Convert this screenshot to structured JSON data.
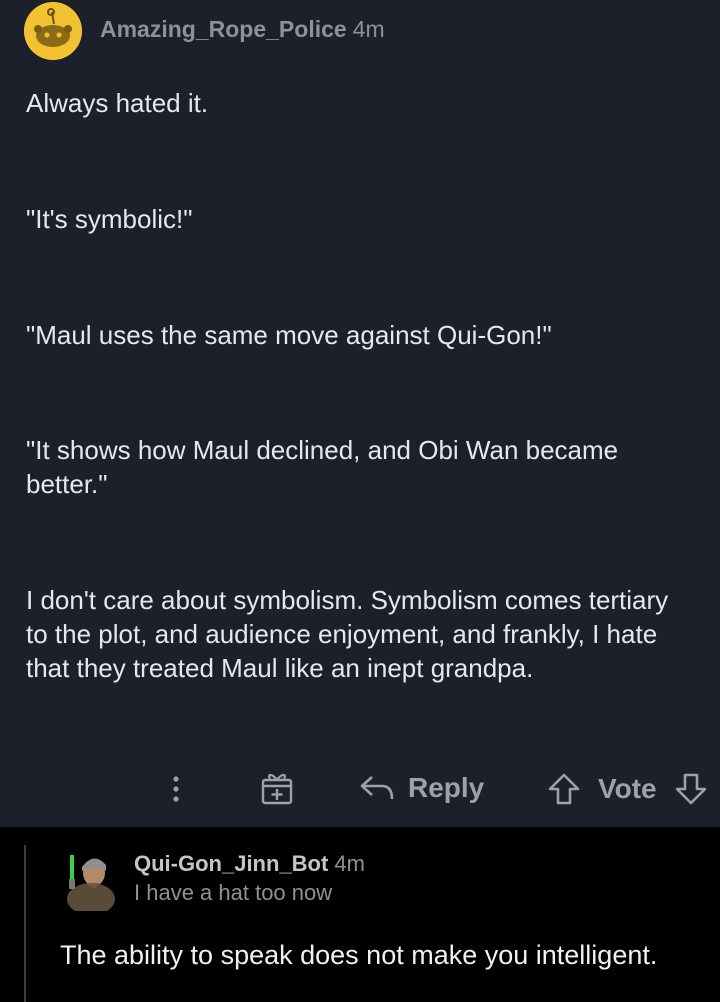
{
  "comment1": {
    "username": "Amazing_Rope_Police",
    "time": "4m",
    "paragraphs": [
      "Always hated it.",
      "\"It's symbolic!\"",
      "\"Maul uses the same move against Qui-Gon!\"",
      "\"It shows how Maul declined, and Obi Wan became better.\"",
      "I don't care about symbolism. Symbolism comes tertiary to the plot, and audience enjoyment, and frankly, I hate that they treated Maul like an inept grandpa."
    ],
    "actions": {
      "more_icon": "more-vertical-icon",
      "award_icon": "award-gift-icon",
      "reply_icon": "reply-arrow-icon",
      "reply_label": "Reply",
      "upvote_icon": "upvote-arrow-icon",
      "vote_label": "Vote",
      "downvote_icon": "downvote-arrow-icon"
    }
  },
  "comment2": {
    "username": "Qui-Gon_Jinn_Bot",
    "time": "4m",
    "flair": "I have a hat too now",
    "body": "The ability to speak does not make you intelligent."
  },
  "colors": {
    "background_dark": "#1b202a",
    "background_black": "#000000",
    "avatar_yellow": "#f2c232",
    "muted_text": "#8e9196",
    "body_text": "#e6e8ea"
  }
}
